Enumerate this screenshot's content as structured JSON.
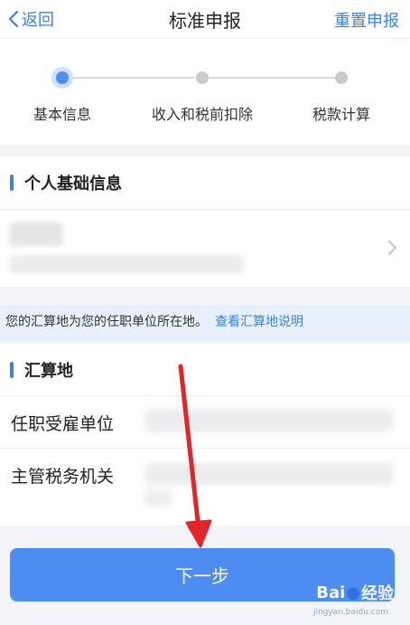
{
  "header": {
    "back_label": "返回",
    "title": "标准申报",
    "reset_label": "重置申报"
  },
  "stepper": {
    "steps": [
      "基本信息",
      "收入和税前扣除",
      "税款计算"
    ],
    "current_step_index": 0
  },
  "personal_section": {
    "title": "个人基础信息"
  },
  "notice": {
    "text": "您的汇算地为您的任职单位所在地。",
    "link": "查看汇算地说明"
  },
  "location_section": {
    "title": "汇算地",
    "fields": [
      {
        "label": "任职受雇单位"
      },
      {
        "label": "主管税务机关"
      }
    ]
  },
  "next_button": {
    "label": "下一步"
  },
  "watermark": {
    "brand_left": "Bai",
    "brand_right": "经验",
    "sub": "jingyan.baidu.com"
  },
  "colors": {
    "accent": "#3a82e4",
    "button": "#4d8cf0",
    "annotation_arrow": "#e0252b"
  }
}
